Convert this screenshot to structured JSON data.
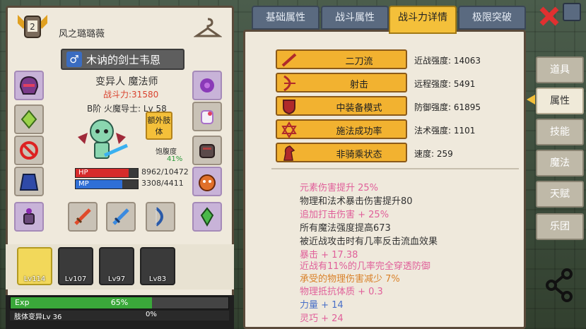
{
  "character": {
    "player_name": "风之璐璐薇",
    "title": "木讷的剑士韦恩",
    "race": "变异人",
    "class": "魔法师",
    "power_label": "战斗力:31580",
    "rank_line": "B阶 火魔导士: Lv 58",
    "extra_limbs_button": "额外肢体",
    "satiety_label": "饱腹度",
    "satiety_value": "41%",
    "hp_label": "HP",
    "hp_text": "8962/10472",
    "hp_fraction": 0.856,
    "mp_label": "MP",
    "mp_text": "3308/4411",
    "mp_fraction": 0.75
  },
  "party": [
    {
      "level": "Lv114",
      "active": true
    },
    {
      "level": "Lv107",
      "active": false
    },
    {
      "level": "Lv97",
      "active": false
    },
    {
      "level": "Lv83",
      "active": false
    }
  ],
  "exp": {
    "label": "Exp",
    "percent_text": "65%",
    "fraction": 0.65,
    "sub_label": "肢体变异Lv 36",
    "sub_percent": "0%"
  },
  "tabs": [
    "基础属性",
    "战斗属性",
    "战斗力详情",
    "极限突破"
  ],
  "active_tab": 2,
  "attributes": [
    {
      "label": "二刀流",
      "value": "近战强度: 14063",
      "icon": "sword-icon"
    },
    {
      "label": "射击",
      "value": "远程强度: 5491",
      "icon": "bow-icon"
    },
    {
      "label": "中装备模式",
      "value": "防御强度: 61895",
      "icon": "shield-icon"
    },
    {
      "label": "施法成功率",
      "value": "法术强度: 1101",
      "icon": "hexagram-icon"
    },
    {
      "label": "非骑乘状态",
      "value": "速度: 259",
      "icon": "horse-icon"
    }
  ],
  "effects": [
    {
      "text": "元素伤害提升 25%",
      "color": "#e0609a"
    },
    {
      "text": "物理和法术暴击伤害提升80",
      "color": "#333333"
    },
    {
      "text": "追加打击伤害 + 25%",
      "color": "#e0609a"
    },
    {
      "text": "所有魔法强度提高673",
      "color": "#333333"
    },
    {
      "text": "被近战攻击时有几率反击流血效果",
      "color": "#333333"
    },
    {
      "text": "暴击 + 17.38",
      "color": "#e0609a"
    },
    {
      "text": "近战有11%的几率完全穿透防御",
      "color": "#e0609a"
    },
    {
      "text": "承受的物理伤害减少 7%",
      "color": "#d9822b"
    },
    {
      "text": "物理抵抗体质 + 0.3",
      "color": "#e0609a"
    },
    {
      "text": "力量 + 14",
      "color": "#4a70c8"
    },
    {
      "text": "灵巧 + 24",
      "color": "#e0609a"
    }
  ],
  "side_menu": [
    {
      "label": "道具",
      "active": false
    },
    {
      "label": "属性",
      "active": true
    },
    {
      "label": "技能",
      "active": false
    },
    {
      "label": "魔法",
      "active": false
    },
    {
      "label": "天赋",
      "active": false
    },
    {
      "label": "乐团",
      "active": false
    }
  ],
  "colors": {
    "accent": "#f4c03a",
    "hp": "#d62b2b",
    "mp": "#2f6fd6",
    "exp": "#3aa83a",
    "close": "#e03030"
  }
}
